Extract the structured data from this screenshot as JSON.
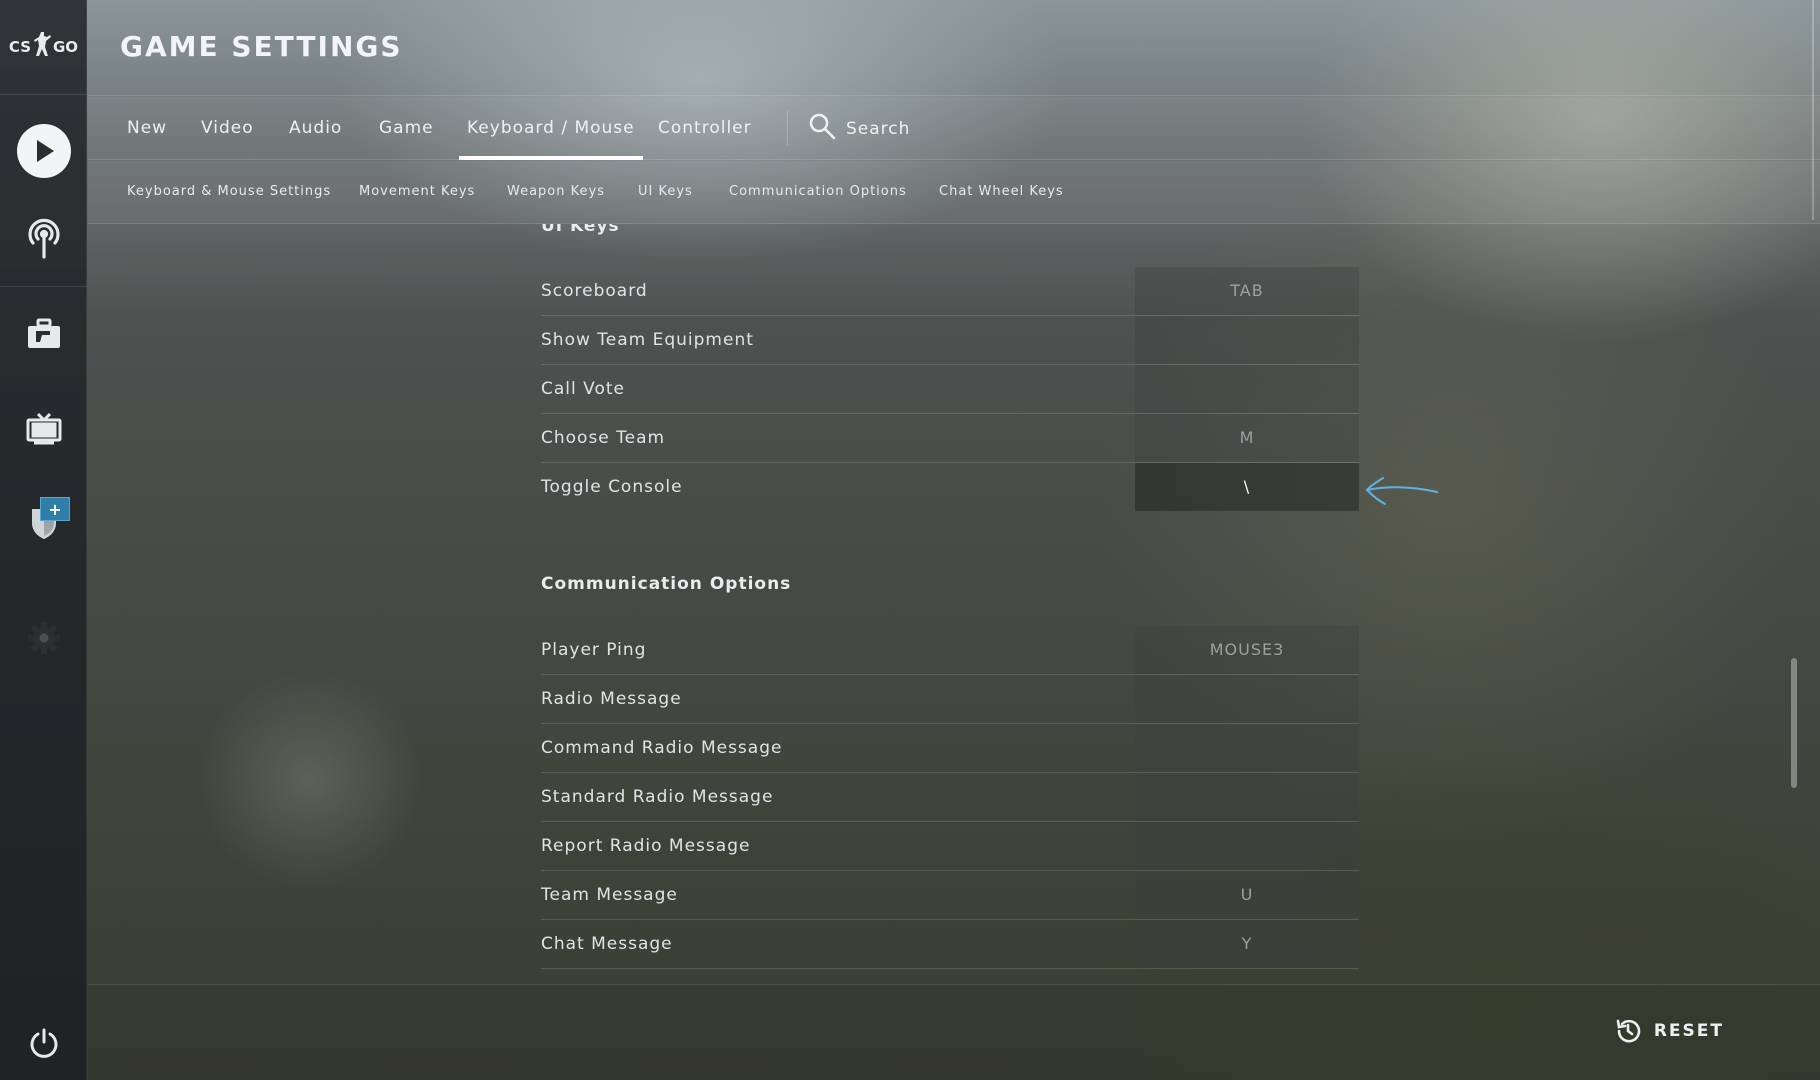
{
  "app": {
    "logo_text_left": "CS",
    "logo_text_right": "GO"
  },
  "page": {
    "title": "GAME SETTINGS"
  },
  "tabs": [
    {
      "label": "New"
    },
    {
      "label": "Video"
    },
    {
      "label": "Audio"
    },
    {
      "label": "Game"
    },
    {
      "label": "Keyboard / Mouse",
      "active": true
    },
    {
      "label": "Controller"
    }
  ],
  "search": {
    "label": "Search"
  },
  "subnav": [
    {
      "label": "Keyboard & Mouse Settings"
    },
    {
      "label": "Movement Keys"
    },
    {
      "label": "Weapon Keys"
    },
    {
      "label": "UI Keys"
    },
    {
      "label": "Communication Options"
    },
    {
      "label": "Chat Wheel Keys"
    }
  ],
  "sidebar": {
    "items": [
      {
        "icon": "play-icon"
      },
      {
        "icon": "broadcast-icon"
      },
      {
        "icon": "inventory-icon"
      },
      {
        "icon": "tv-icon"
      },
      {
        "icon": "shield-icon",
        "badge": "+"
      },
      {
        "icon": "gear-icon"
      }
    ],
    "bottom_icon": "power-icon"
  },
  "ui_keys": {
    "header": "UI Keys",
    "rows": [
      {
        "label": "Scoreboard",
        "key": "TAB"
      },
      {
        "label": "Show Team Equipment",
        "key": ""
      },
      {
        "label": "Call Vote",
        "key": ""
      },
      {
        "label": "Choose Team",
        "key": "M"
      },
      {
        "label": "Toggle Console",
        "key": "\\"
      }
    ]
  },
  "communication": {
    "header": "Communication Options",
    "rows": [
      {
        "label": "Player Ping",
        "key": "MOUSE3"
      },
      {
        "label": "Radio Message",
        "key": ""
      },
      {
        "label": "Command Radio Message",
        "key": ""
      },
      {
        "label": "Standard Radio Message",
        "key": ""
      },
      {
        "label": "Report Radio Message",
        "key": ""
      },
      {
        "label": "Team Message",
        "key": "U"
      },
      {
        "label": "Chat Message",
        "key": "Y"
      }
    ]
  },
  "footer": {
    "reset_label": "RESET"
  },
  "colors": {
    "accent_badge": "#2f7ea8",
    "annotation_arrow": "#5fb3e0"
  }
}
